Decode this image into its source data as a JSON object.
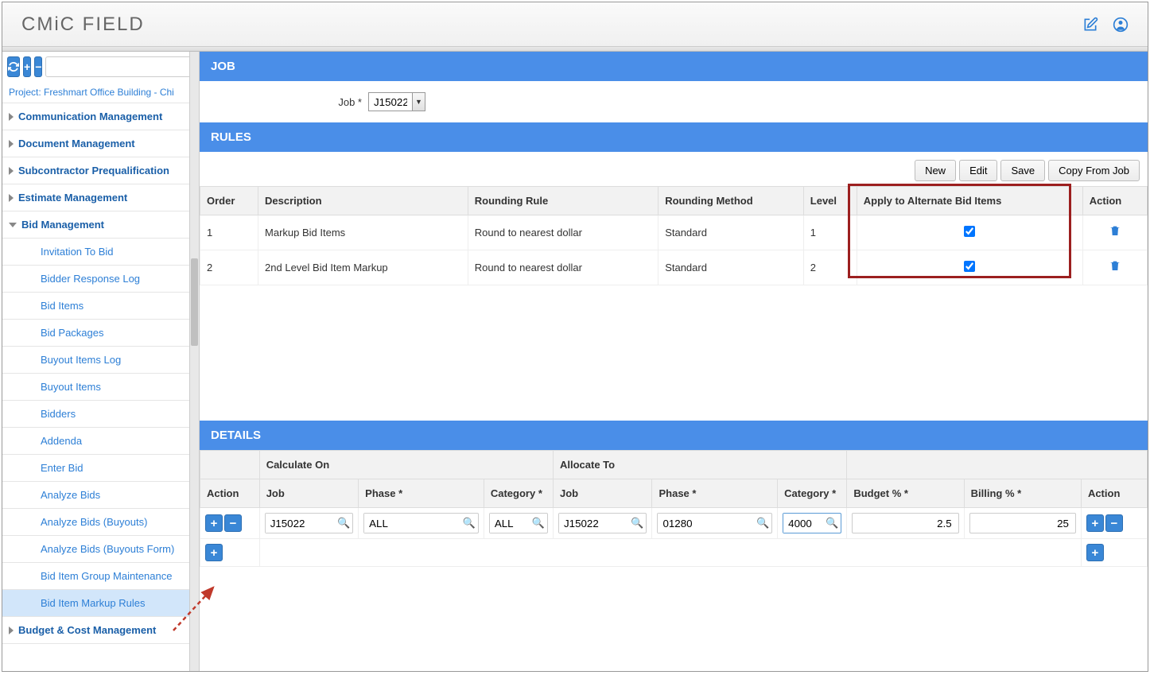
{
  "header": {
    "logo": "CMiC FIELD"
  },
  "sidebar": {
    "project_label": "Project: Freshmart Office Building - Chi",
    "items": [
      {
        "label": "Communication Management"
      },
      {
        "label": "Document Management"
      },
      {
        "label": "Subcontractor Prequalification"
      },
      {
        "label": "Estimate Management"
      },
      {
        "label": "Bid Management",
        "expanded": true
      },
      {
        "label": "Budget & Cost Management"
      }
    ],
    "bid_children": [
      "Invitation To Bid",
      "Bidder Response Log",
      "Bid Items",
      "Bid Packages",
      "Buyout Items Log",
      "Buyout Items",
      "Bidders",
      "Addenda",
      "Enter Bid",
      "Analyze Bids",
      "Analyze Bids (Buyouts)",
      "Analyze Bids (Buyouts Form)",
      "Bid Item Group Maintenance",
      "Bid Item Markup Rules"
    ]
  },
  "job": {
    "section": "JOB",
    "label": "Job *",
    "value": "J15022"
  },
  "rules": {
    "section": "RULES",
    "buttons": {
      "new": "New",
      "edit": "Edit",
      "save": "Save",
      "copy": "Copy From Job"
    },
    "columns": {
      "order": "Order",
      "description": "Description",
      "rounding_rule": "Rounding Rule",
      "rounding_method": "Rounding Method",
      "level": "Level",
      "apply": "Apply to Alternate Bid Items",
      "action": "Action"
    },
    "rows": [
      {
        "order": "1",
        "description": "Markup Bid Items",
        "rounding_rule": "Round to nearest dollar",
        "rounding_method": "Standard",
        "level": "1",
        "apply": true
      },
      {
        "order": "2",
        "description": "2nd Level Bid Item Markup",
        "rounding_rule": "Round to nearest dollar",
        "rounding_method": "Standard",
        "level": "2",
        "apply": true
      }
    ]
  },
  "details": {
    "section": "DETAILS",
    "group_headers": {
      "calculate_on": "Calculate On",
      "allocate_to": "Allocate To"
    },
    "columns": {
      "action_l": "Action",
      "job_c": "Job",
      "phase_c": "Phase *",
      "category_c": "Category *",
      "job_a": "Job",
      "phase_a": "Phase *",
      "category_a": "Category *",
      "budget": "Budget % *",
      "billing": "Billing % *",
      "action_r": "Action"
    },
    "row": {
      "job_c": "J15022",
      "phase_c": "ALL",
      "category_c": "ALL",
      "job_a": "J15022",
      "phase_a": "01280",
      "category_a": "4000",
      "budget": "2.5",
      "billing": "25"
    }
  }
}
